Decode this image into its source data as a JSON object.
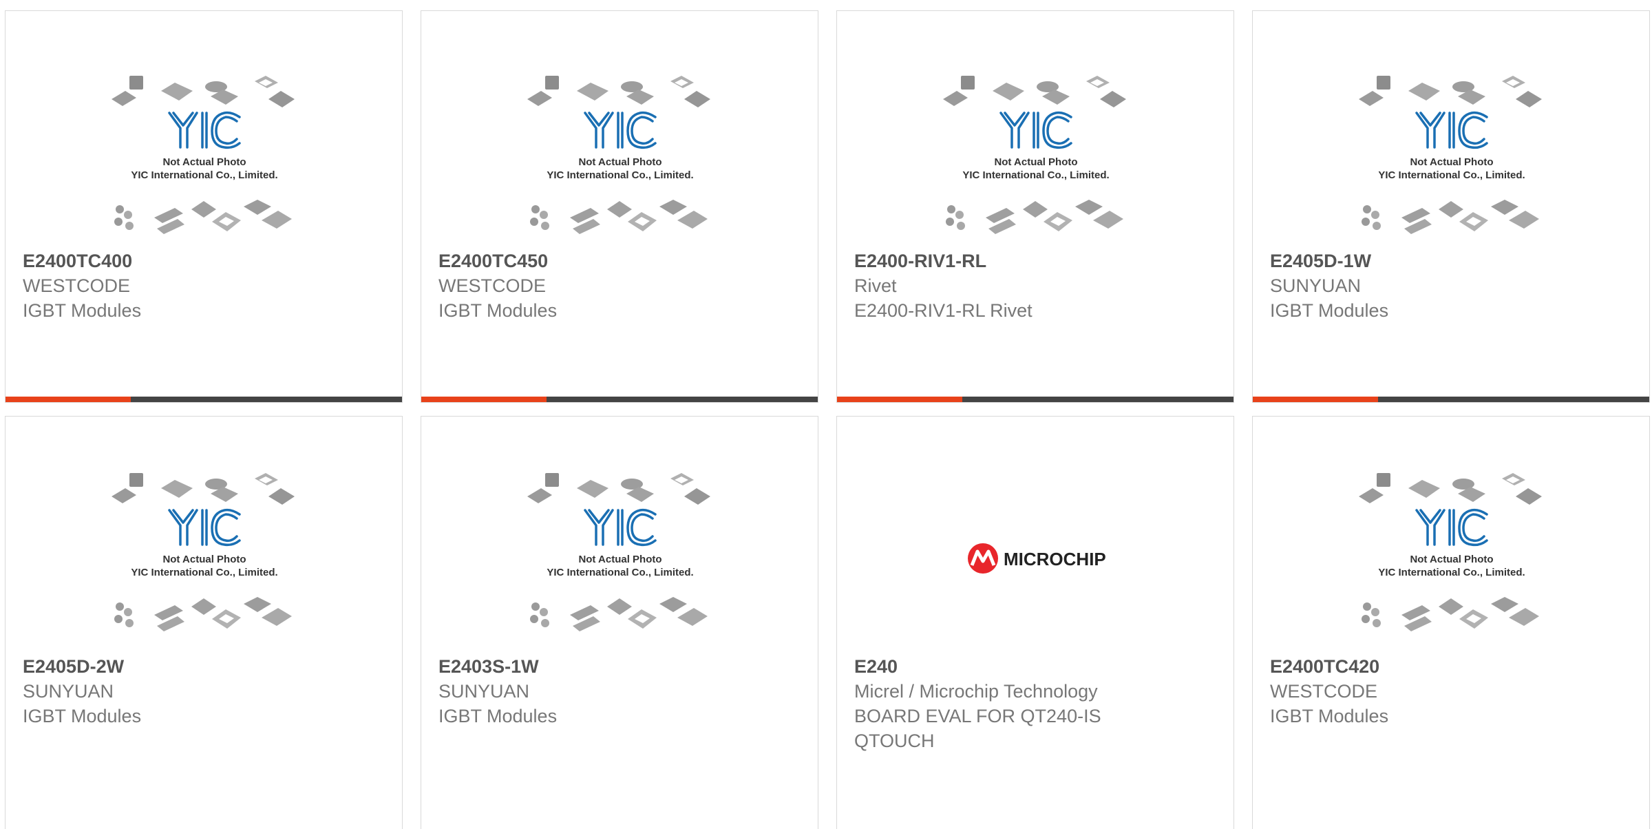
{
  "placeholder_image": {
    "caption_line1": "Not Actual Photo",
    "caption_line2": "YIC International Co., Limited.",
    "logo_text": "YIC"
  },
  "microchip_logo": {
    "text": "MICROCHIP"
  },
  "colors": {
    "accent": "#e8421a",
    "bar": "#444444",
    "logo_blue": "#1a6fb3"
  },
  "products": [
    {
      "part": "E2400TC400",
      "line1": "WESTCODE",
      "line2": "IGBT Modules",
      "line3": "",
      "image": "placeholder"
    },
    {
      "part": "E2400TC450",
      "line1": "WESTCODE",
      "line2": "IGBT Modules",
      "line3": "",
      "image": "placeholder"
    },
    {
      "part": "E2400-RIV1-RL",
      "line1": "Rivet",
      "line2": "E2400-RIV1-RL Rivet",
      "line3": "",
      "image": "placeholder"
    },
    {
      "part": "E2405D-1W",
      "line1": "SUNYUAN",
      "line2": "IGBT Modules",
      "line3": "",
      "image": "placeholder"
    },
    {
      "part": "E2405D-2W",
      "line1": "SUNYUAN",
      "line2": "IGBT Modules",
      "line3": "",
      "image": "placeholder"
    },
    {
      "part": "E2403S-1W",
      "line1": "SUNYUAN",
      "line2": "IGBT Modules",
      "line3": "",
      "image": "placeholder"
    },
    {
      "part": "E240",
      "line1": "Micrel / Microchip Technology",
      "line2": "BOARD EVAL FOR QT240-IS",
      "line3": "QTOUCH",
      "image": "microchip"
    },
    {
      "part": "E2400TC420",
      "line1": "WESTCODE",
      "line2": "IGBT Modules",
      "line3": "",
      "image": "placeholder"
    }
  ]
}
